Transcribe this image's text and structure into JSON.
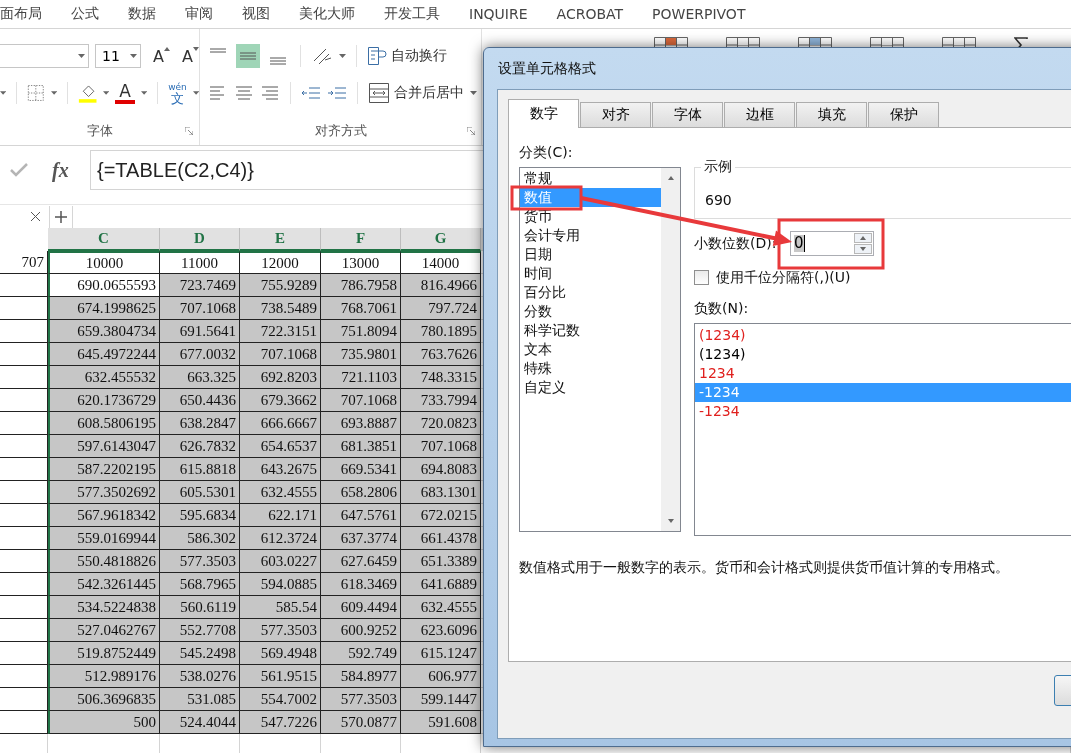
{
  "menu_tabs": [
    "面布局",
    "公式",
    "数据",
    "审阅",
    "视图",
    "美化大师",
    "开发工具",
    "INQUIRE",
    "ACROBAT",
    "POWERPIVOT"
  ],
  "ribbon": {
    "font_size": "11",
    "grow_font": "A",
    "shrink_font": "A",
    "font_color": "A",
    "phonetic": {
      "top": "wén",
      "bottom": "文"
    },
    "font_group_label": "字体",
    "vertical_align": [
      {
        "kind": "top",
        "selected": false
      },
      {
        "kind": "middle",
        "selected": true
      },
      {
        "kind": "bottom",
        "selected": false
      }
    ],
    "wrap_text": "自动换行",
    "merge_center": "合并后居中",
    "alignment_group_label": "对齐方式"
  },
  "formula_bar": {
    "function_button": "fx",
    "formula": "{=TABLE(C2,C4)}"
  },
  "sheet": {
    "columns": [
      "C",
      "D",
      "E",
      "F",
      "G"
    ],
    "header_row": {
      "label": "707",
      "values": [
        "10000",
        "11000",
        "12000",
        "13000",
        "14000"
      ]
    },
    "rows": [
      {
        "active": true,
        "cells": [
          "690.0655593",
          "723.7469",
          "755.9289",
          "786.7958",
          "816.4966"
        ]
      },
      {
        "active": false,
        "cells": [
          "674.1998625",
          "707.1068",
          "738.5489",
          "768.7061",
          "797.724"
        ]
      },
      {
        "active": false,
        "cells": [
          "659.3804734",
          "691.5641",
          "722.3151",
          "751.8094",
          "780.1895"
        ]
      },
      {
        "active": false,
        "cells": [
          "645.4972244",
          "677.0032",
          "707.1068",
          "735.9801",
          "763.7626"
        ]
      },
      {
        "active": false,
        "cells": [
          "632.455532",
          "663.325",
          "692.8203",
          "721.1103",
          "748.3315"
        ]
      },
      {
        "active": false,
        "cells": [
          "620.1736729",
          "650.4436",
          "679.3662",
          "707.1068",
          "733.7994"
        ]
      },
      {
        "active": false,
        "cells": [
          "608.5806195",
          "638.2847",
          "666.6667",
          "693.8887",
          "720.0823"
        ]
      },
      {
        "active": false,
        "cells": [
          "597.6143047",
          "626.7832",
          "654.6537",
          "681.3851",
          "707.1068"
        ]
      },
      {
        "active": false,
        "cells": [
          "587.2202195",
          "615.8818",
          "643.2675",
          "669.5341",
          "694.8083"
        ]
      },
      {
        "active": false,
        "cells": [
          "577.3502692",
          "605.5301",
          "632.4555",
          "658.2806",
          "683.1301"
        ]
      },
      {
        "active": false,
        "cells": [
          "567.9618342",
          "595.6834",
          "622.171",
          "647.5761",
          "672.0215"
        ]
      },
      {
        "active": false,
        "cells": [
          "559.0169944",
          "586.302",
          "612.3724",
          "637.3774",
          "661.4378"
        ]
      },
      {
        "active": false,
        "cells": [
          "550.4818826",
          "577.3503",
          "603.0227",
          "627.6459",
          "651.3389"
        ]
      },
      {
        "active": false,
        "cells": [
          "542.3261445",
          "568.7965",
          "594.0885",
          "618.3469",
          "641.6889"
        ]
      },
      {
        "active": false,
        "cells": [
          "534.5224838",
          "560.6119",
          "585.54",
          "609.4494",
          "632.4555"
        ]
      },
      {
        "active": false,
        "cells": [
          "527.0462767",
          "552.7708",
          "577.3503",
          "600.9252",
          "623.6096"
        ]
      },
      {
        "active": false,
        "cells": [
          "519.8752449",
          "545.2498",
          "569.4948",
          "592.749",
          "615.1247"
        ]
      },
      {
        "active": false,
        "cells": [
          "512.989176",
          "538.0276",
          "561.9515",
          "584.8977",
          "606.977"
        ]
      },
      {
        "active": false,
        "cells": [
          "506.3696835",
          "531.085",
          "554.7002",
          "577.3503",
          "599.1447"
        ]
      },
      {
        "active": false,
        "cells": [
          "500",
          "524.4044",
          "547.7226",
          "570.0877",
          "591.608"
        ]
      }
    ]
  },
  "dialog": {
    "title": "设置单元格格式",
    "tabs": [
      {
        "label": "数字",
        "selected": true
      },
      {
        "label": "对齐",
        "selected": false
      },
      {
        "label": "字体",
        "selected": false
      },
      {
        "label": "边框",
        "selected": false
      },
      {
        "label": "填充",
        "selected": false
      },
      {
        "label": "保护",
        "selected": false
      }
    ],
    "category_label": "分类(C):",
    "categories": [
      {
        "label": "常规",
        "selected": false
      },
      {
        "label": "数值",
        "selected": true
      },
      {
        "label": "货币",
        "selected": false
      },
      {
        "label": "会计专用",
        "selected": false
      },
      {
        "label": "日期",
        "selected": false
      },
      {
        "label": "时间",
        "selected": false
      },
      {
        "label": "百分比",
        "selected": false
      },
      {
        "label": "分数",
        "selected": false
      },
      {
        "label": "科学记数",
        "selected": false
      },
      {
        "label": "文本",
        "selected": false
      },
      {
        "label": "特殊",
        "selected": false
      },
      {
        "label": "自定义",
        "selected": false
      }
    ],
    "sample_label": "示例",
    "sample_value": "690",
    "decimal_label": "小数位数(D):",
    "decimal_value": "0",
    "thousands": {
      "label": "使用千位分隔符(,)(U)",
      "checked": false
    },
    "negative_label": "负数(N):",
    "negatives": [
      {
        "label": "(1234)",
        "color": "#e0201e",
        "selected": false
      },
      {
        "label": "(1234)",
        "color": "#000000",
        "selected": false
      },
      {
        "label": "1234",
        "color": "#e0201e",
        "selected": false
      },
      {
        "label": "-1234",
        "color": "#ffffff",
        "selected": true
      },
      {
        "label": "-1234",
        "color": "#e0201e",
        "selected": false
      }
    ],
    "description": "数值格式用于一般数字的表示。货币和会计格式则提供货币值计算的专用格式。"
  }
}
